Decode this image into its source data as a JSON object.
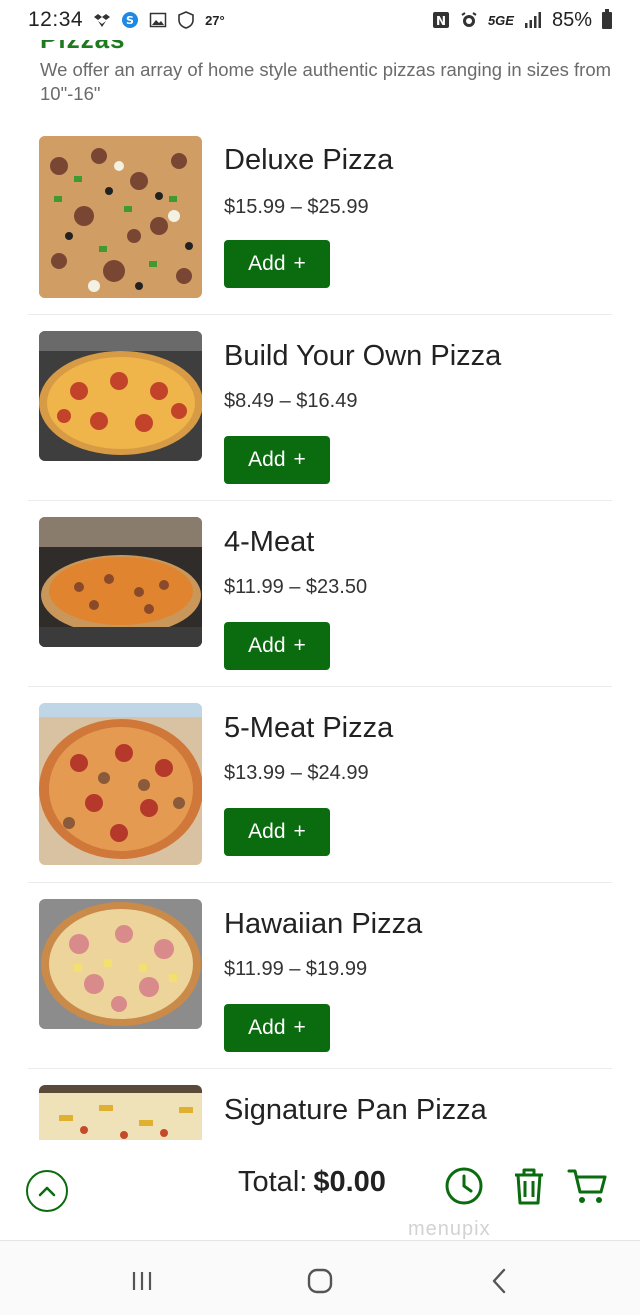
{
  "status_bar": {
    "time": "12:34",
    "temperature": "27°",
    "network": "5GE",
    "battery": "85%"
  },
  "section": {
    "title": "Pizzas",
    "description": "We offer an array of home style authentic pizzas ranging in sizes from 10\"-16\""
  },
  "menu": {
    "add_label": "Add",
    "add_symbol": "+",
    "items": [
      {
        "name": "Deluxe Pizza",
        "price": "$15.99 – $25.99"
      },
      {
        "name": "Build Your Own Pizza",
        "price": "$8.49 – $16.49"
      },
      {
        "name": "4-Meat",
        "price": "$11.99 – $23.50"
      },
      {
        "name": "5-Meat Pizza",
        "price": "$13.99 – $24.99"
      },
      {
        "name": "Hawaiian Pizza",
        "price": "$11.99 – $19.99"
      },
      {
        "name": "Signature Pan Pizza",
        "price": ""
      }
    ]
  },
  "order_bar": {
    "total_label": "Total:",
    "total_value": "$0.00",
    "watermark": "menupix"
  },
  "icons": {
    "scroll_top": "chevron-up-icon",
    "clock": "clock-icon",
    "trash": "trash-icon",
    "cart": "cart-icon"
  },
  "colors": {
    "accent": "#0a6b0f",
    "heading": "#1e7a1e"
  }
}
